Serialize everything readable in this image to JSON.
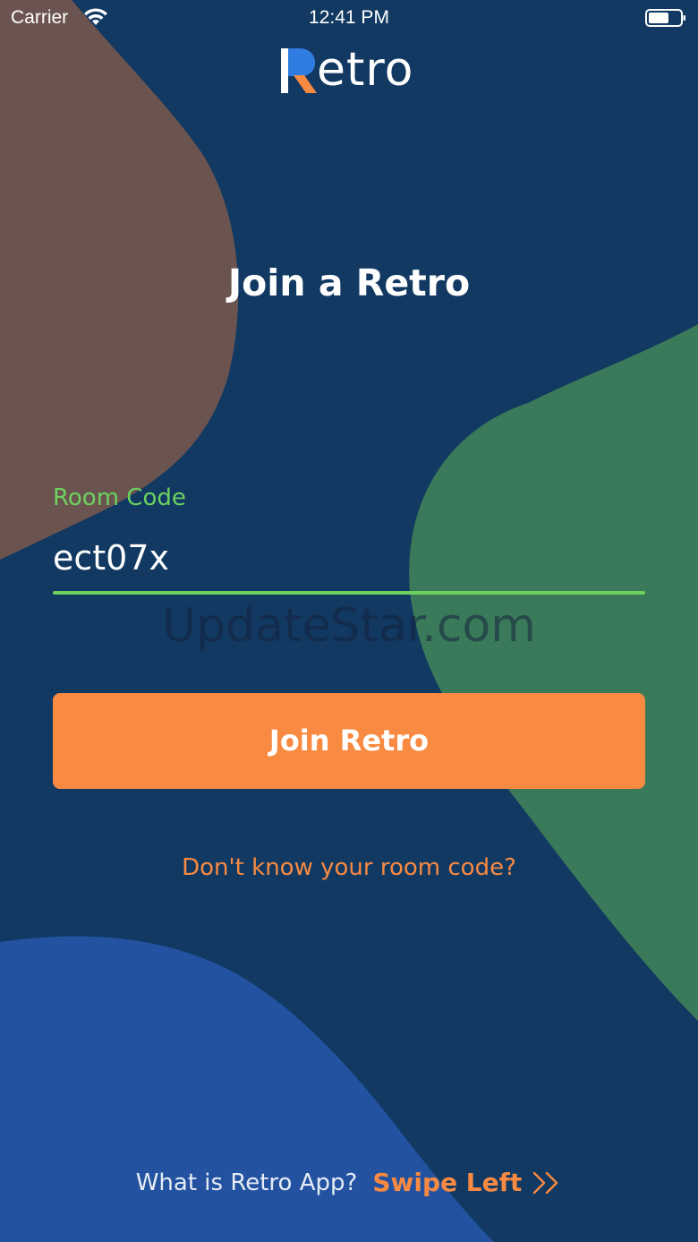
{
  "status_bar": {
    "carrier": "Carrier",
    "time": "12:41 PM",
    "wifi_icon": "wifi-icon",
    "battery_icon": "battery-icon"
  },
  "brand": {
    "logo_initial": "R",
    "logo_rest": "etro",
    "logo_accent_color": "#f88a42",
    "logo_mark_color": "#2f7de1"
  },
  "title": "Join a Retro",
  "room_code": {
    "label": "Room Code",
    "value": "ect07x"
  },
  "watermark": "UpdateStar.com",
  "join_button": {
    "label": "Join Retro"
  },
  "help_link": "Don't know your room code?",
  "footer": {
    "question": "What is Retro App?",
    "swipe_label": "Swipe Left",
    "swipe_icon": "double-chevron-right-icon"
  },
  "colors": {
    "background": "#123962",
    "accent_orange": "#f88a42",
    "accent_green": "#6dd15e",
    "shape_brown": "#6b5450",
    "shape_green": "#3a7a5a",
    "shape_blue": "#2252a0"
  }
}
